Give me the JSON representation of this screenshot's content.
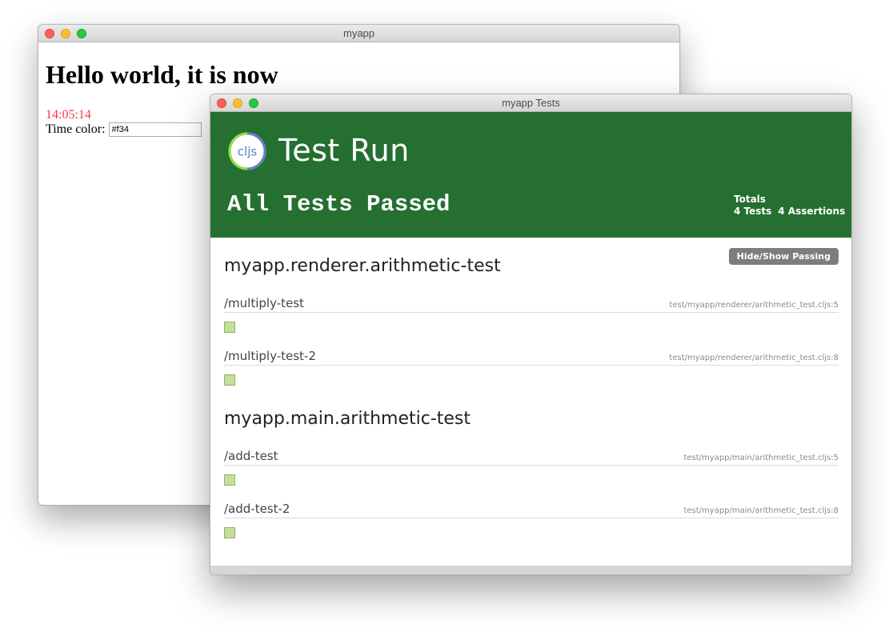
{
  "windows": {
    "app": {
      "title": "myapp",
      "heading": "Hello world, it is now",
      "time": "14:05:14",
      "time_color_label": "Time color:",
      "time_color_value": "#f34",
      "time_color_accent": "#ff3344"
    },
    "tests": {
      "title": "myapp Tests",
      "logo_text": "cljs",
      "header_title": "Test Run",
      "status": "All Tests Passed",
      "totals": {
        "label": "Totals",
        "tests": "4 Tests",
        "assertions": "4 Assertions"
      },
      "toggle_button": "Hide/Show Passing",
      "banner_color": "#256f31",
      "pass_color": "#c3df9a",
      "namespaces": [
        {
          "name": "myapp.renderer.arithmetic-test",
          "tests": [
            {
              "name": "/multiply-test",
              "file": "test/myapp/renderer/arithmetic_test.cljs:5"
            },
            {
              "name": "/multiply-test-2",
              "file": "test/myapp/renderer/arithmetic_test.cljs:8"
            }
          ]
        },
        {
          "name": "myapp.main.arithmetic-test",
          "tests": [
            {
              "name": "/add-test",
              "file": "test/myapp/main/arithmetic_test.cljs:5"
            },
            {
              "name": "/add-test-2",
              "file": "test/myapp/main/arithmetic_test.cljs:8"
            }
          ]
        }
      ]
    }
  }
}
